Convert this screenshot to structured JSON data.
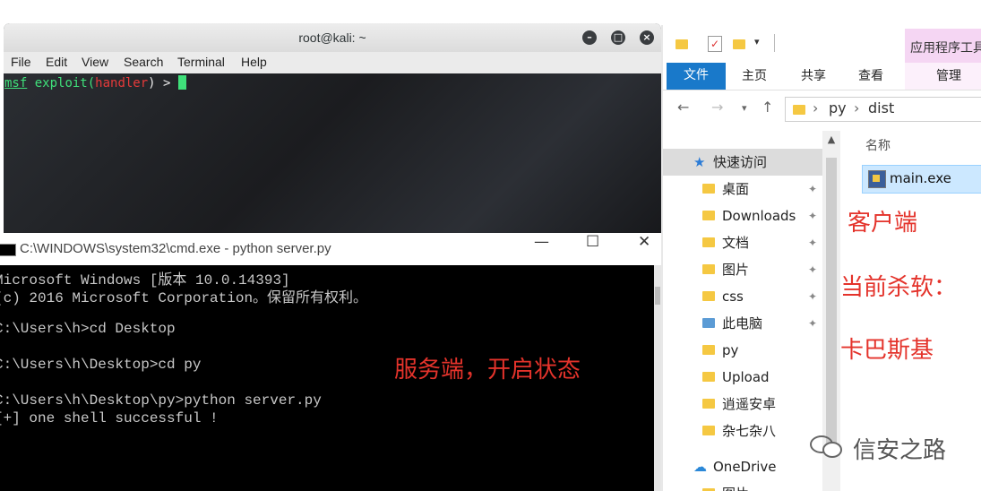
{
  "kali_terminal": {
    "title": "root@kali: ~",
    "menu": [
      "File",
      "Edit",
      "View",
      "Search",
      "Terminal",
      "Help"
    ],
    "prompt_msf": "msf",
    "prompt_exploit": " exploit(",
    "prompt_handler": "handler",
    "prompt_end": ") > "
  },
  "cmd_window": {
    "title": "C:\\WINDOWS\\system32\\cmd.exe - python  server.py",
    "lines": [
      "Microsoft Windows [版本 10.0.14393]",
      "(c) 2016 Microsoft Corporation。保留所有权利。",
      "",
      "C:\\Users\\h>cd Desktop",
      "",
      "C:\\Users\\h\\Desktop>cd py",
      "",
      "C:\\Users\\h\\Desktop\\py>python server.py",
      "[+] one shell successful !"
    ],
    "annotation": "服务端，开启状态"
  },
  "explorer": {
    "tools_tab": "应用程序工具",
    "ribbon_tabs": [
      "文件",
      "主页",
      "共享",
      "查看",
      "管理"
    ],
    "breadcrumb": [
      "py",
      "dist"
    ],
    "column_header": "名称",
    "nav_items": [
      {
        "label": "快速访问",
        "pinned": false
      },
      {
        "label": "桌面",
        "pinned": true
      },
      {
        "label": "Downloads",
        "pinned": true
      },
      {
        "label": "文档",
        "pinned": true
      },
      {
        "label": "图片",
        "pinned": true
      },
      {
        "label": "css",
        "pinned": true
      },
      {
        "label": "此电脑",
        "pinned": true
      },
      {
        "label": "py",
        "pinned": false
      },
      {
        "label": "Upload",
        "pinned": false
      },
      {
        "label": "逍遥安卓",
        "pinned": false
      },
      {
        "label": "杂七杂八",
        "pinned": false
      },
      {
        "label": "OneDrive",
        "pinned": false
      },
      {
        "label": "图片",
        "pinned": false
      }
    ],
    "file": "main.exe"
  },
  "annotations": {
    "client": "客户端",
    "av_current": "当前杀软：",
    "av_name": "卡巴斯基"
  },
  "watermark": "信安之路",
  "colors": {
    "annotation_red": "#e4332b",
    "terminal_green": "#3fe07a",
    "file_tab_blue": "#1979ca",
    "tools_pink": "#f5d6f3"
  }
}
